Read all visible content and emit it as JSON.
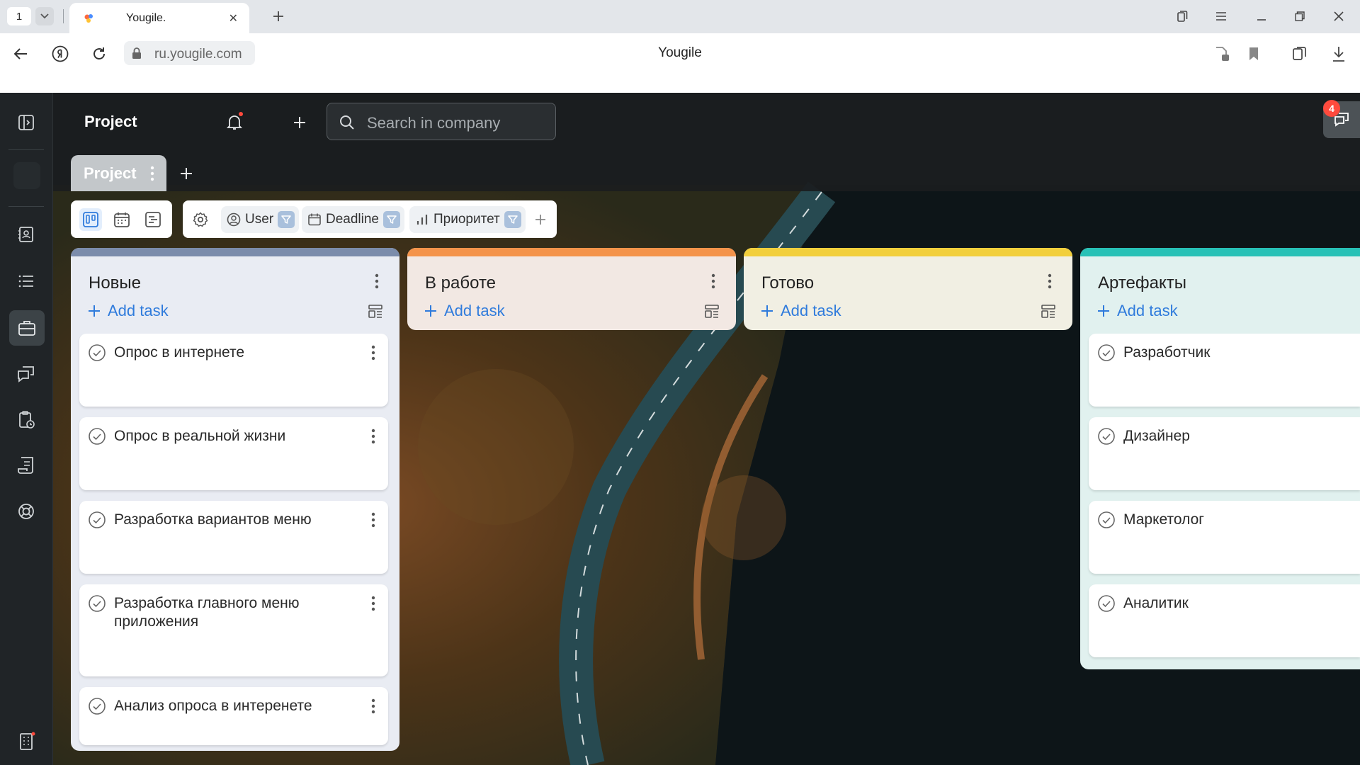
{
  "browser": {
    "tab_count": "1",
    "tab_title": "Yougile.",
    "url": "ru.yougile.com",
    "page_title": "Yougile"
  },
  "app": {
    "project_title": "Project",
    "search_placeholder": "Search in company",
    "project_tab": "Project",
    "chat_badge": "4",
    "filters": {
      "user": "User",
      "deadline": "Deadline",
      "priority": "Приоритет"
    },
    "add_task_label": "Add task",
    "columns": [
      {
        "title": "Новые",
        "color": "#7b8cab",
        "tint": "#e9ecf3",
        "cards": [
          "Опрос в интернете",
          "Опрос в реальной жизни",
          "Разработка вариантов меню",
          "Разработка главного меню приложения",
          "Анализ опроса в интеренете"
        ]
      },
      {
        "title": "В работе",
        "color": "#f4934a",
        "tint": "#f2e8e3",
        "cards": []
      },
      {
        "title": "Готово",
        "color": "#f2cf3c",
        "tint": "#f1efe3",
        "cards": []
      },
      {
        "title": "Артефакты",
        "color": "#27c1b6",
        "tint": "#e1f1ef",
        "cards": [
          "Разработчик",
          "Дизайнер",
          "Маркетолог",
          "Аналитик"
        ]
      }
    ]
  }
}
